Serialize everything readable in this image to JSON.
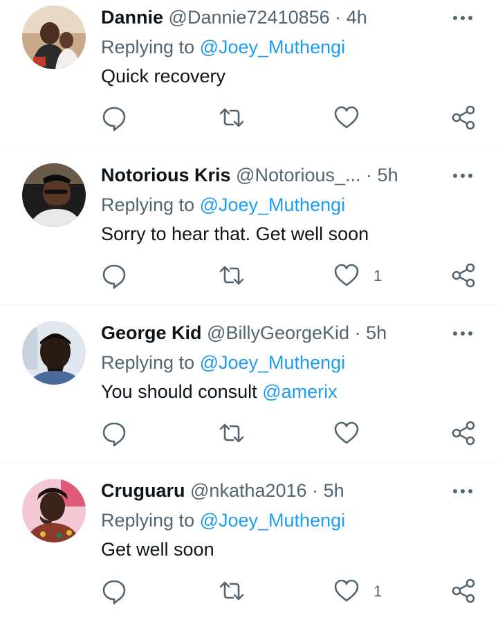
{
  "replies": [
    {
      "name": "Dannie",
      "handle": "@Dannie72410856",
      "sep": "·",
      "time": "4h",
      "replying_prefix": "Replying to ",
      "replying_to": "@Joey_Muthengi",
      "text": "Quick recovery",
      "text_mention": "",
      "like_count": ""
    },
    {
      "name": "Notorious Kris",
      "handle": "@Notorious_...",
      "sep": "·",
      "time": "5h",
      "replying_prefix": "Replying to ",
      "replying_to": "@Joey_Muthengi",
      "text": "Sorry to hear that. Get well soon",
      "text_mention": "",
      "like_count": "1"
    },
    {
      "name": "George Kid",
      "handle": "@BillyGeorgeKid",
      "sep": "·",
      "time": "5h",
      "replying_prefix": "Replying to ",
      "replying_to": "@Joey_Muthengi",
      "text": "You should consult ",
      "text_mention": "@amerix",
      "like_count": ""
    },
    {
      "name": "Cruguaru",
      "handle": "@nkatha2016",
      "sep": "·",
      "time": "5h",
      "replying_prefix": "Replying to ",
      "replying_to": "@Joey_Muthengi",
      "text": "Get well soon",
      "text_mention": "",
      "like_count": "1"
    }
  ],
  "colors": {
    "text": "#0f1419",
    "secondary": "#536471",
    "link": "#1d9bf0",
    "divider": "#eff3f4"
  },
  "icons": [
    "more-icon",
    "reply-icon",
    "retweet-icon",
    "like-icon",
    "share-icon"
  ]
}
